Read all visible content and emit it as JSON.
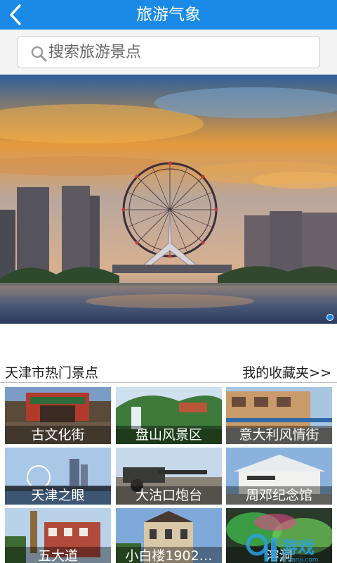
{
  "header": {
    "title": "旅游气象",
    "back_icon": "chevron-left-icon"
  },
  "search": {
    "placeholder": "搜索旅游景点",
    "icon": "search-icon"
  },
  "banner": {
    "description_icon": "ferris-wheel-photo",
    "active_dot_color": "#1a8ae6"
  },
  "section": {
    "title": "天津市热门景点",
    "favorites_link": "我的收藏夹>>"
  },
  "spots": [
    {
      "label": "古文化街"
    },
    {
      "label": "盘山风景区"
    },
    {
      "label": "意大利风情街"
    },
    {
      "label": "天津之眼"
    },
    {
      "label": "大沽口炮台"
    },
    {
      "label": "周邓纪念馆"
    },
    {
      "label": "五大道"
    },
    {
      "label": "小白楼1902…"
    },
    {
      "label": "溶洞"
    }
  ],
  "watermark": {
    "brand": "9游戏",
    "site": "www.91danji.com"
  },
  "colors": {
    "primary": "#1a8ae6"
  }
}
